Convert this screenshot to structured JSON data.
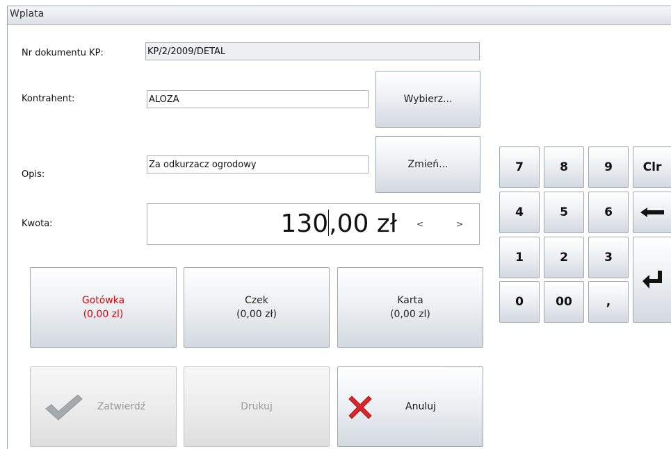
{
  "window": {
    "title": "Wplata"
  },
  "form": {
    "doc_label": "Nr dokumentu KP:",
    "doc_value": "KP/2/2009/DETAL",
    "contractor_label": "Kontrahent:",
    "contractor_value": "ALOZA",
    "description_label": "Opis:",
    "description_value": "Za odkurzacz ogrodowy",
    "amount_label": "Kwota:",
    "amount_int": "130",
    "amount_frac": ",00 zł",
    "arrow_left": "<",
    "arrow_right": ">"
  },
  "buttons": {
    "choose": "Wybierz...",
    "change": "Zmień...",
    "confirm": "Zatwierdź",
    "print": "Drukuj",
    "cancel": "Anuluj"
  },
  "payment": [
    {
      "name": "Gotówka",
      "amount": "(0,00 zl)",
      "color": "#e00000"
    },
    {
      "name": "Czek",
      "amount": "(0,00 zł)",
      "color": "#222222"
    },
    {
      "name": "Karta",
      "amount": "(0,00 zl)",
      "color": "#222222"
    }
  ],
  "keypad": {
    "k7": "7",
    "k8": "8",
    "k9": "9",
    "clr": "Clr",
    "k4": "4",
    "k5": "5",
    "k6": "6",
    "k1": "1",
    "k2": "2",
    "k3": "3",
    "k0": "0",
    "k00": "00",
    "comma": ",",
    "backspace_icon": "left-arrow-icon",
    "enter_icon": "enter-icon"
  },
  "colors": {
    "accent_cash": "#e00000",
    "check_icon": "#a7aaad",
    "cancel_icon": "#d8262b"
  }
}
